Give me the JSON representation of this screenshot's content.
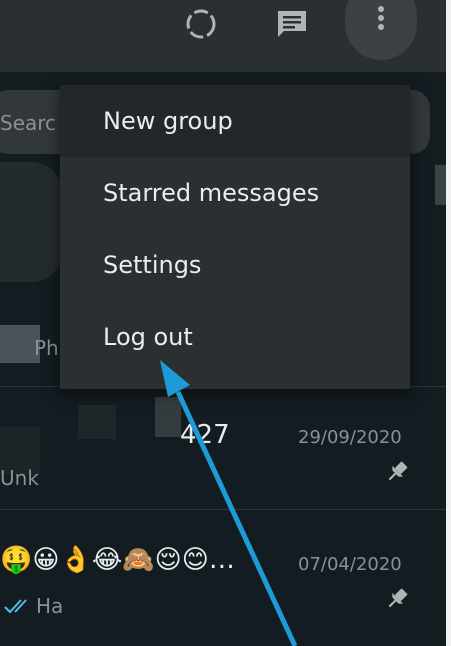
{
  "header": {
    "status_icon": "status-ring-icon",
    "chat_icon": "new-chat-icon",
    "menu_icon": "more-vertical-icon"
  },
  "search": {
    "placeholder": "Search or start new chat",
    "visible_text": "Searc"
  },
  "menu": {
    "items": [
      {
        "label": "New group"
      },
      {
        "label": "Starred messages"
      },
      {
        "label": "Settings"
      },
      {
        "label": "Log out"
      }
    ]
  },
  "chats": [
    {
      "preview_fragment": "Ph"
    },
    {
      "name_fragment": "427",
      "date": "29/09/2020",
      "preview_fragment": "Unk",
      "pinned": true
    },
    {
      "emojis": "🤑😀👌😂🙈😌😊…",
      "date": "07/04/2020",
      "preview_fragment": "Ha",
      "pinned": true
    }
  ],
  "colors": {
    "background": "#131c21",
    "panel": "#2a2f32",
    "text_primary": "#e9edef",
    "text_secondary": "#8a9094",
    "annotation_arrow": "#1e9bd7",
    "ticks": "#53bdeb"
  }
}
